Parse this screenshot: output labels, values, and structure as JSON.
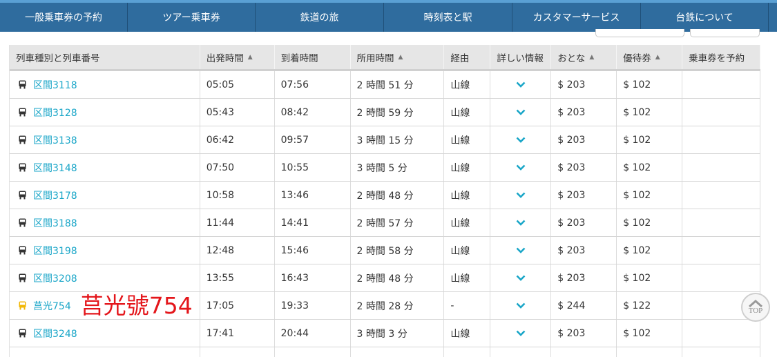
{
  "nav": {
    "items": [
      {
        "label": "一般乗車券の予約",
        "w": 185
      },
      {
        "label": "ツアー乗車券",
        "w": 185
      },
      {
        "label": "鉄道の旅",
        "w": 186
      },
      {
        "label": "時刻表と駅",
        "w": 186
      },
      {
        "label": "カスタマーサービス",
        "w": 186
      },
      {
        "label": "台鉄について",
        "w": 185
      }
    ]
  },
  "table": {
    "headers": {
      "train": "列車種別と列車番号",
      "depart": "出発時間",
      "arrive": "到着時間",
      "duration": "所用時間",
      "via": "経由",
      "details": "詳しい情報",
      "adult": "おとな",
      "discount": "優待券",
      "book": "乗車券を予約"
    },
    "sort_glyph": "▲",
    "rows": [
      {
        "train": "区間3118",
        "depart": "05:05",
        "arrive": "07:56",
        "duration": "2 時間 51 分",
        "via": "山線",
        "adult": "$ 203",
        "discount": "$ 102"
      },
      {
        "train": "区間3128",
        "depart": "05:43",
        "arrive": "08:42",
        "duration": "2 時間 59 分",
        "via": "山線",
        "adult": "$ 203",
        "discount": "$ 102"
      },
      {
        "train": "区間3138",
        "depart": "06:42",
        "arrive": "09:57",
        "duration": "3 時間 15 分",
        "via": "山線",
        "adult": "$ 203",
        "discount": "$ 102"
      },
      {
        "train": "区間3148",
        "depart": "07:50",
        "arrive": "10:55",
        "duration": "3 時間 5 分",
        "via": "山線",
        "adult": "$ 203",
        "discount": "$ 102"
      },
      {
        "train": "区間3178",
        "depart": "10:58",
        "arrive": "13:46",
        "duration": "2 時間 48 分",
        "via": "山線",
        "adult": "$ 203",
        "discount": "$ 102"
      },
      {
        "train": "区間3188",
        "depart": "11:44",
        "arrive": "14:41",
        "duration": "2 時間 57 分",
        "via": "山線",
        "adult": "$ 203",
        "discount": "$ 102"
      },
      {
        "train": "区間3198",
        "depart": "12:48",
        "arrive": "15:46",
        "duration": "2 時間 58 分",
        "via": "山線",
        "adult": "$ 203",
        "discount": "$ 102"
      },
      {
        "train": "区間3208",
        "depart": "13:55",
        "arrive": "16:43",
        "duration": "2 時間 48 分",
        "via": "山線",
        "adult": "$ 203",
        "discount": "$ 102"
      },
      {
        "train": "莒光754",
        "depart": "17:05",
        "arrive": "19:33",
        "duration": "2 時間 28 分",
        "via": "-",
        "adult": "$ 244",
        "discount": "$ 122",
        "annotation": "莒光號754",
        "express": true
      },
      {
        "train": "区間3248",
        "depart": "17:41",
        "arrive": "20:44",
        "duration": "3 時間 3 分",
        "via": "山線",
        "adult": "$ 203",
        "discount": "$ 102"
      }
    ]
  },
  "top_button": {
    "label": "TOP"
  },
  "colors": {
    "nav_bg": "#2f6c9e",
    "link": "#1aa6c8",
    "chevron": "#1aa6c8",
    "local_train_icon": "#333333",
    "express_train_icon": "#f2b705",
    "annotation": "#e4161b"
  }
}
